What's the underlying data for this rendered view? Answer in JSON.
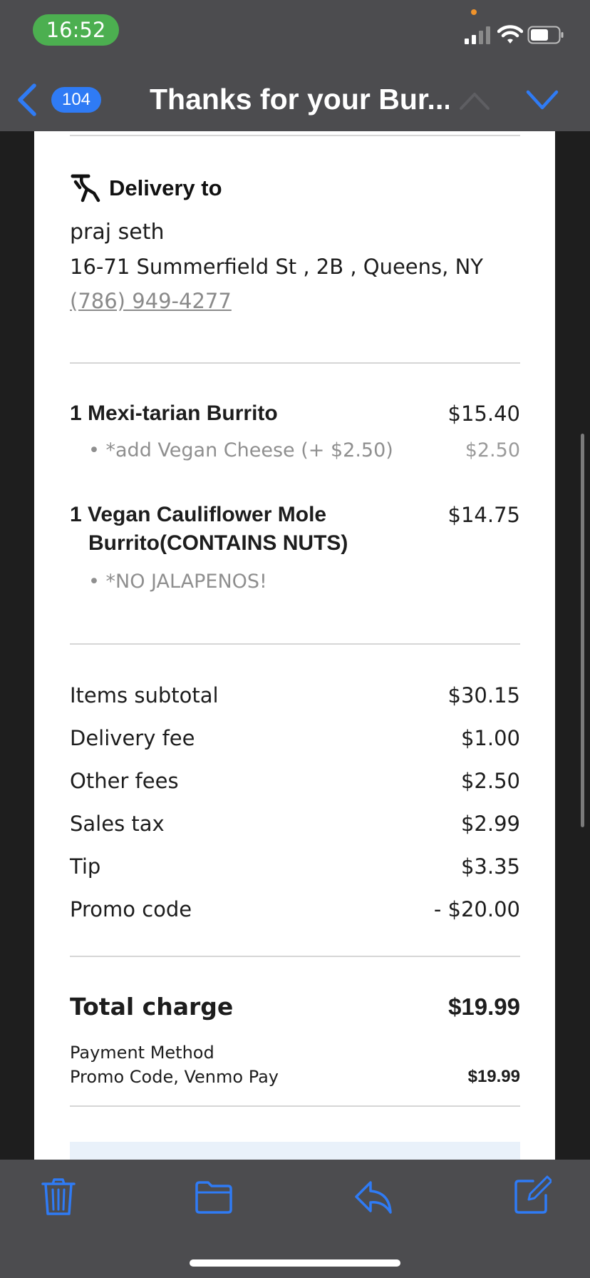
{
  "status_bar": {
    "time": "16:52"
  },
  "header": {
    "unread_count": "104",
    "title": "Thanks for your Bur..."
  },
  "delivery": {
    "heading": "Delivery to",
    "name": "praj seth",
    "address": "16-71 Summerfield St , 2B , Queens, NY",
    "phone": "(786) 949-4277"
  },
  "items": [
    {
      "name": "1 Mexi-tarian Burrito",
      "price": "$15.40",
      "modifiers": [
        {
          "text": "• *add Vegan Cheese (+ $2.50)",
          "price": "$2.50"
        }
      ]
    },
    {
      "name_line1": "1 Vegan Cauliflower Mole",
      "name_line2": "Burrito(CONTAINS NUTS)",
      "price": "$14.75",
      "modifiers": [
        {
          "text": "• *NO JALAPENOS!",
          "price": ""
        }
      ]
    }
  ],
  "fees": [
    {
      "label": "Items subtotal",
      "value": "$30.15"
    },
    {
      "label": "Delivery fee",
      "value": "$1.00"
    },
    {
      "label": "Other fees",
      "value": "$2.50"
    },
    {
      "label": "Sales tax",
      "value": "$2.99"
    },
    {
      "label": "Tip",
      "value": "$3.35"
    },
    {
      "label": "Promo code",
      "value": "- $20.00"
    }
  ],
  "total": {
    "label": "Total charge",
    "value": "$19.99",
    "payment_method_label": "Payment Method",
    "payment_method_value": "Promo Code, Venmo Pay",
    "payment_amount": "$19.99"
  },
  "toolbar": {
    "icons": [
      "trash-icon",
      "folder-icon",
      "reply-icon",
      "compose-icon"
    ]
  },
  "colors": {
    "accent": "#2f7bf5",
    "time_pill": "#4caf50",
    "chrome": "#4c4c4f"
  }
}
